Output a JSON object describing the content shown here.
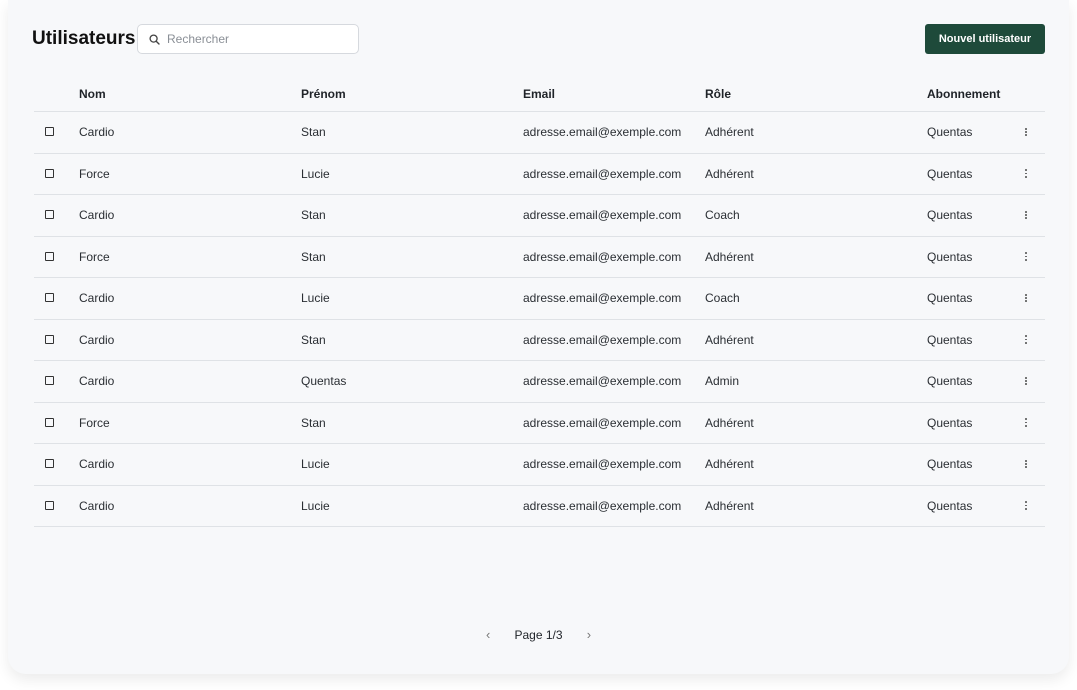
{
  "header": {
    "title": "Utilisateurs",
    "search_placeholder": "Rechercher",
    "search_value": "",
    "new_user_label": "Nouvel utilisateur"
  },
  "colors": {
    "primary_button": "#1e4a3a",
    "background": "#f7f8fa",
    "divider": "#dfe2e6"
  },
  "table": {
    "columns": [
      "Nom",
      "Prénom",
      "Email",
      "Rôle",
      "Abonnement"
    ],
    "rows": [
      {
        "nom": "Cardio",
        "prenom": "Stan",
        "email": "adresse.email@exemple.com",
        "role": "Adhérent",
        "abonnement": "Quentas"
      },
      {
        "nom": "Force",
        "prenom": "Lucie",
        "email": "adresse.email@exemple.com",
        "role": "Adhérent",
        "abonnement": "Quentas"
      },
      {
        "nom": "Cardio",
        "prenom": "Stan",
        "email": "adresse.email@exemple.com",
        "role": "Coach",
        "abonnement": "Quentas"
      },
      {
        "nom": "Force",
        "prenom": "Stan",
        "email": "adresse.email@exemple.com",
        "role": "Adhérent",
        "abonnement": "Quentas"
      },
      {
        "nom": "Cardio",
        "prenom": "Lucie",
        "email": "adresse.email@exemple.com",
        "role": "Coach",
        "abonnement": "Quentas"
      },
      {
        "nom": "Cardio",
        "prenom": "Stan",
        "email": "adresse.email@exemple.com",
        "role": "Adhérent",
        "abonnement": "Quentas"
      },
      {
        "nom": "Cardio",
        "prenom": "Quentas",
        "email": "adresse.email@exemple.com",
        "role": "Admin",
        "abonnement": "Quentas"
      },
      {
        "nom": "Force",
        "prenom": "Stan",
        "email": "adresse.email@exemple.com",
        "role": "Adhérent",
        "abonnement": "Quentas"
      },
      {
        "nom": "Cardio",
        "prenom": "Lucie",
        "email": "adresse.email@exemple.com",
        "role": "Adhérent",
        "abonnement": "Quentas"
      },
      {
        "nom": "Cardio",
        "prenom": "Lucie",
        "email": "adresse.email@exemple.com",
        "role": "Adhérent",
        "abonnement": "Quentas"
      }
    ],
    "row_icons": {
      "select": "checkbox-icon",
      "actions": "more-vertical-icon"
    }
  },
  "pagination": {
    "label": "Page 1/3",
    "prev_icon": "chevron-left-icon",
    "next_icon": "chevron-right-icon"
  }
}
